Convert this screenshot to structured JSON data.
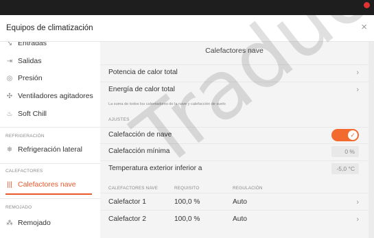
{
  "dialog": {
    "title": "Equipos de climatización",
    "close_label": "×"
  },
  "sidebar": {
    "items": [
      {
        "label": "Entradas",
        "icon": "input-icon",
        "glyph": "↘"
      },
      {
        "label": "Salidas",
        "icon": "output-icon",
        "glyph": "⇥"
      },
      {
        "label": "Presión",
        "icon": "gauge-icon",
        "glyph": "◎"
      },
      {
        "label": "Ventiladores agitadores",
        "icon": "fan-icon",
        "glyph": "✣"
      },
      {
        "label": "Soft Chill",
        "icon": "mist-icon",
        "glyph": "♨"
      },
      {
        "label": "Refrigeración lateral",
        "icon": "snowflake-icon",
        "glyph": "❄"
      },
      {
        "label": "Calefactores nave",
        "icon": "heater-icon",
        "glyph": "|||"
      },
      {
        "label": "Remojado",
        "icon": "spray-icon",
        "glyph": "⁂"
      }
    ],
    "sections": {
      "refrigeracion": "REFRIGERACIÓN",
      "calefactores": "CALEFACTORES",
      "remojado": "REMOJADO"
    },
    "accent": "#e8562a"
  },
  "main": {
    "title": "Calefactores nave",
    "rows": {
      "potencia": "Potencia de calor total",
      "energia": "Energía de calor total"
    },
    "chevron": "›",
    "note": "La suma de todos los calentadores de la nave y calefacción de suelo",
    "ajustes_label": "AJUSTES",
    "settings": {
      "calefaccion_nave": {
        "label": "Calefacción de nave",
        "on": true,
        "check": "✓"
      },
      "calefaccion_minima": {
        "label": "Calefacción mínima",
        "value": "0 %"
      },
      "temp_exterior": {
        "label": "Temperatura exterior inferior a",
        "value": "-5,0 °C"
      }
    },
    "table": {
      "headers": [
        "CALEFACTORES NAVE",
        "REQUISITO",
        "REGULACIÓN"
      ],
      "rows": [
        {
          "name": "Calefactor 1",
          "req": "100,0 %",
          "reg": "Auto"
        },
        {
          "name": "Calefactor 2",
          "req": "100,0 %",
          "reg": "Auto"
        }
      ]
    },
    "toggle_color": "#f26a2e"
  },
  "watermark": "Traduo"
}
